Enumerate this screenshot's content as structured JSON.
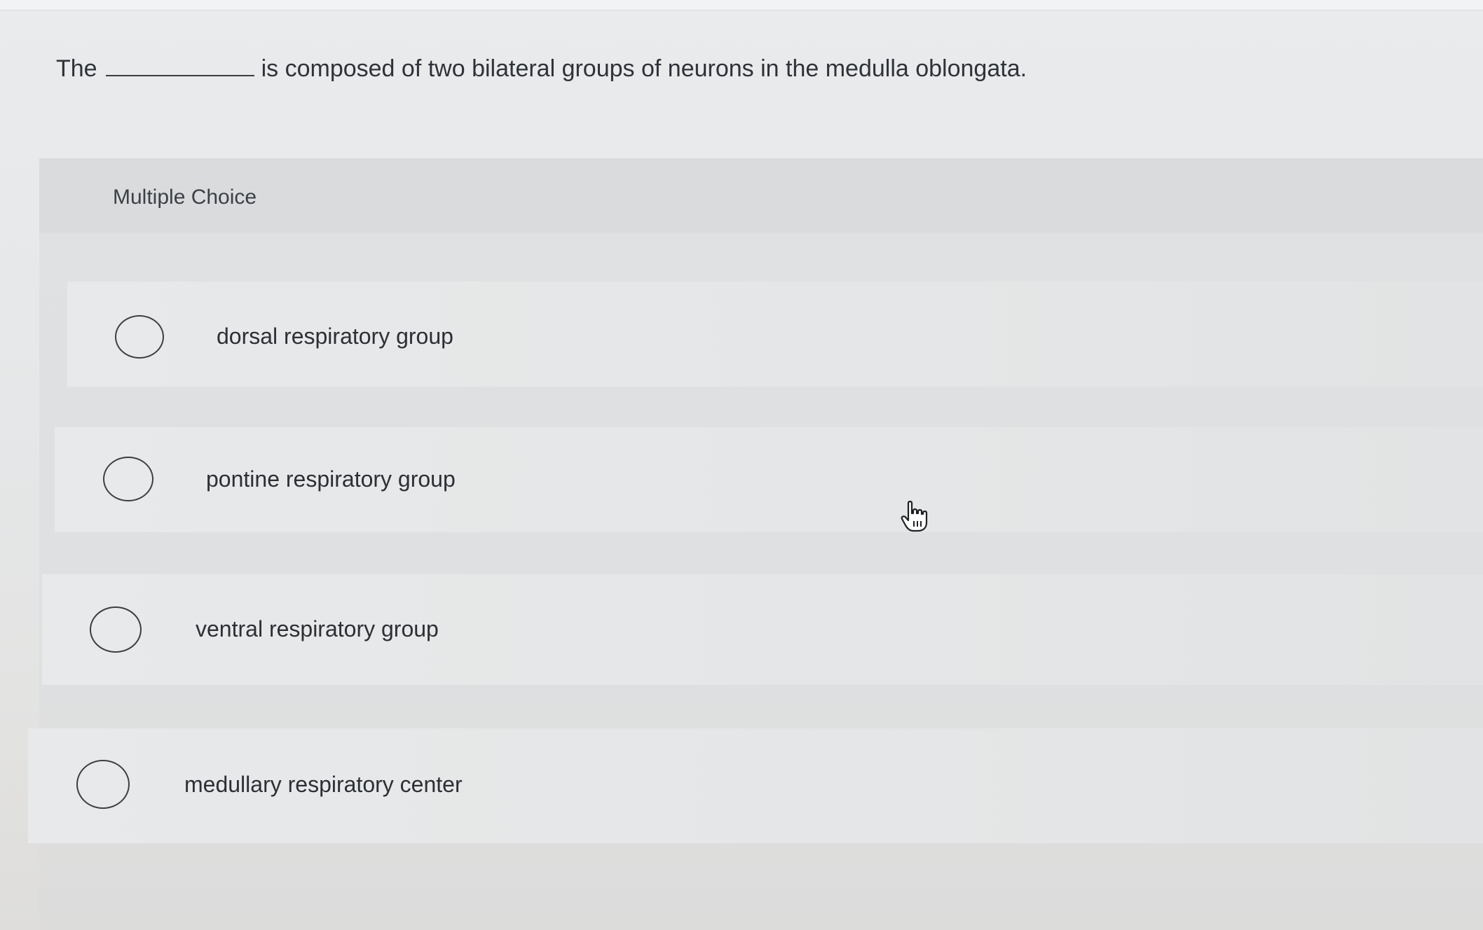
{
  "question": {
    "prefix": "The",
    "suffix": "is composed of two bilateral groups of neurons in the medulla oblongata."
  },
  "multiple_choice": {
    "title": "Multiple Choice",
    "options": [
      {
        "label": "dorsal respiratory group",
        "selected": false
      },
      {
        "label": "pontine respiratory group",
        "selected": false
      },
      {
        "label": "ventral respiratory group",
        "selected": false
      },
      {
        "label": "medullary respiratory center",
        "selected": false
      }
    ]
  },
  "icons": {
    "radio": "radio-button-icon",
    "cursor": "hand-pointer-icon"
  }
}
